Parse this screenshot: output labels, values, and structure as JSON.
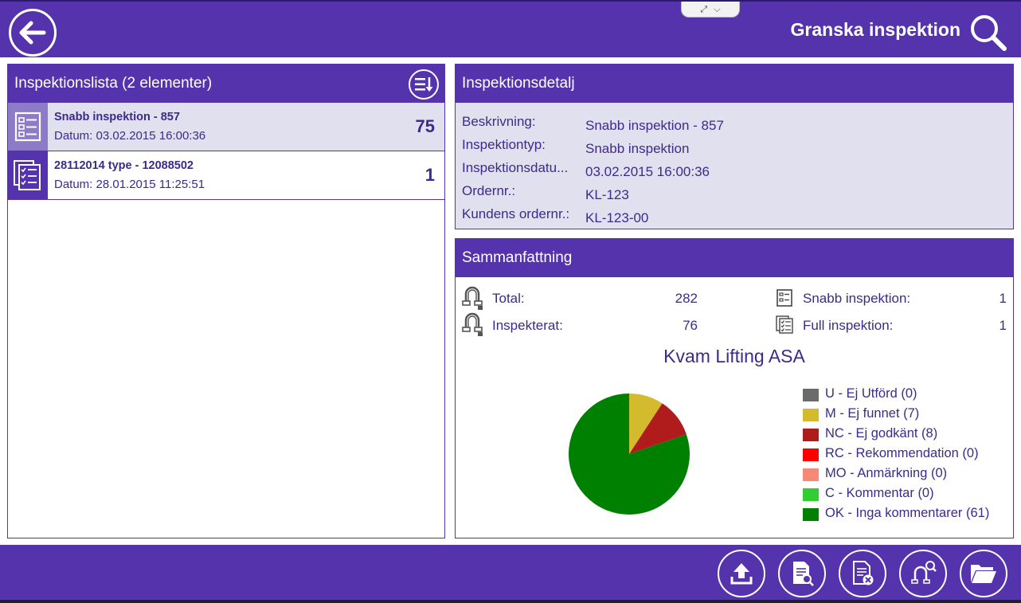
{
  "header": {
    "title": "Granska inspektion",
    "back_icon": "arrow-left-icon",
    "search_icon": "search-icon"
  },
  "list_panel": {
    "title": "Inspektionslista (2 elementer)",
    "sort_icon": "sort-list-icon",
    "items": [
      {
        "title": "Snabb inspektion - 857",
        "date": "Datum: 03.02.2015 16:00:36",
        "count": "75",
        "icon": "quick-checklist-icon",
        "selected": true
      },
      {
        "title": "28112014 type - 12088502",
        "date": "Datum: 28.01.2015 11:25:51",
        "count": "1",
        "icon": "full-checklist-icon",
        "selected": false
      }
    ]
  },
  "detail_panel": {
    "title": "Inspektionsdetalj",
    "rows": [
      {
        "label": "Beskrivning:",
        "value": "Snabb inspektion - 857"
      },
      {
        "label": "Inspektiontyp:",
        "value": "Snabb inspektion"
      },
      {
        "label": "Inspektionsdatu...",
        "value": "03.02.2015 16:00:36"
      },
      {
        "label": "Ordernr.:",
        "value": "KL-123"
      },
      {
        "label": "Kundens ordernr.:",
        "value": "KL-123-00"
      }
    ]
  },
  "summary_panel": {
    "title": "Sammanfattning",
    "total_label": "Total:",
    "total_value": "282",
    "inspected_label": "Inspekterat:",
    "inspected_value": "76",
    "quick_label": "Snabb inspektion:",
    "quick_value": "1",
    "full_label": "Full inspektion:",
    "full_value": "1"
  },
  "chart_data": {
    "type": "pie",
    "title": "Kvam Lifting ASA",
    "legend_position": "right",
    "slices": [
      {
        "label": "U - Ej Utförd (0)",
        "value": 0,
        "color": "#6b6b6b"
      },
      {
        "label": "M - Ej funnet (7)",
        "value": 7,
        "color": "#d4bb2e"
      },
      {
        "label": "NC - Ej godkänt (8)",
        "value": 8,
        "color": "#b01c1c"
      },
      {
        "label": "RC - Rekommendation (0)",
        "value": 0,
        "color": "#ff0000"
      },
      {
        "label": "MO - Anmärkning (0)",
        "value": 0,
        "color": "#f58a78"
      },
      {
        "label": "C - Kommentar (0)",
        "value": 0,
        "color": "#32cd32"
      },
      {
        "label": "OK - Inga kommentarer (61)",
        "value": 61,
        "color": "#008000"
      }
    ]
  },
  "toolbar": {
    "buttons": [
      {
        "name": "upload-button",
        "icon": "upload-icon"
      },
      {
        "name": "view-report-button",
        "icon": "document-search-icon"
      },
      {
        "name": "delete-report-button",
        "icon": "document-delete-icon"
      },
      {
        "name": "search-shackle-button",
        "icon": "shackle-search-icon"
      },
      {
        "name": "open-folder-button",
        "icon": "folder-open-icon"
      }
    ]
  },
  "colors": {
    "primary": "#5533ad",
    "selected_row": "#e1e0ee",
    "text": "#3d2a8a"
  }
}
